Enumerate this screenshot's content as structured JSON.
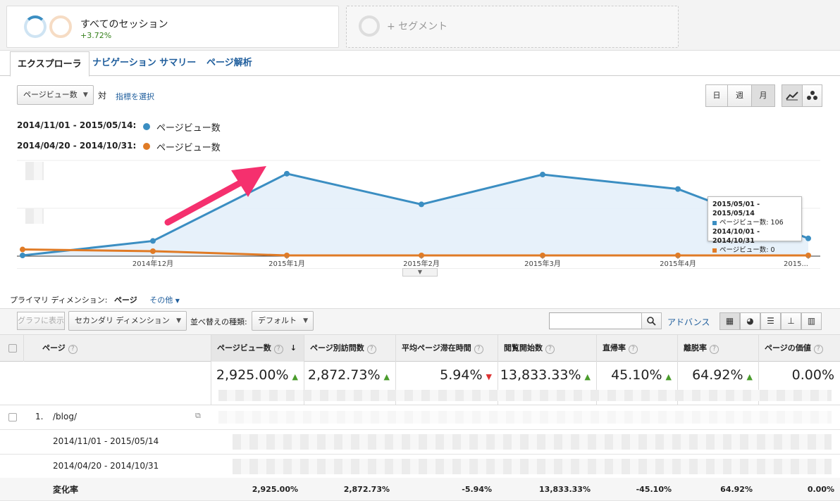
{
  "segments": {
    "active": {
      "title": "すべてのセッション",
      "change": "+3.72%"
    },
    "add_label": "+ セグメント"
  },
  "tabs": [
    {
      "label": "エクスプローラ",
      "active": true
    },
    {
      "label": "ナビゲーション サマリー",
      "active": false
    },
    {
      "label": "ページ解析",
      "active": false
    }
  ],
  "controls": {
    "metric_select": "ページビュー数",
    "vs_label": "対",
    "choose_metric": "指標を選択",
    "period_buttons": [
      "日",
      "週",
      "月"
    ],
    "active_period": "月"
  },
  "legend": [
    {
      "date": "2014/11/01 - 2015/05/14:",
      "label": "ページビュー数",
      "color": "#3b8ec2"
    },
    {
      "date": "2014/04/20 - 2014/10/31:",
      "label": "ページビュー数",
      "color": "#e07b26"
    }
  ],
  "chart_data": {
    "type": "line",
    "categories": [
      "",
      "2014年12月",
      "2015年1月",
      "2015年2月",
      "2015年3月",
      "2015年4月",
      "2015..."
    ],
    "series": [
      {
        "name": "2014/11/01 - 2015/05/14",
        "color": "#3b8ec2",
        "values": [
          0,
          0.17,
          0.96,
          0.6,
          0.95,
          0.78,
          0.2
        ]
      },
      {
        "name": "2014/04/20 - 2014/10/31",
        "color": "#e07b26",
        "values": [
          0.07,
          0.05,
          0,
          0,
          0,
          0,
          0
        ]
      }
    ]
  },
  "tooltip": {
    "range1": "2015/05/01 - 2015/05/14",
    "value1": "ページビュー数: 106",
    "range2": "2014/10/01 - 2014/10/31",
    "value2": "ページビュー数: 0"
  },
  "dimension": {
    "label": "プライマリ ディメンション:",
    "active": "ページ",
    "other": "その他"
  },
  "toolbar": {
    "plot_rows": "グラフに表示",
    "secondary_dimension": "セカンダリ ディメンション",
    "sort_label": "並べ替えの種類:",
    "sort_value": "デフォルト",
    "advanced": "アドバンス"
  },
  "table": {
    "columns": [
      "ページ",
      "ページビュー数",
      "ページ別訪問数",
      "平均ページ滞在時間",
      "閲覧開始数",
      "直帰率",
      "離脱率",
      "ページの価値"
    ],
    "summary": [
      {
        "value": "2,925.00%",
        "dir": "up"
      },
      {
        "value": "2,872.73%",
        "dir": "up"
      },
      {
        "value": "5.94%",
        "dir": "down"
      },
      {
        "value": "13,833.33%",
        "dir": "up"
      },
      {
        "value": "45.10%",
        "dir": "up"
      },
      {
        "value": "64.92%",
        "dir": "up"
      },
      {
        "value": "0.00%",
        "dir": ""
      }
    ],
    "row1": {
      "index": "1.",
      "page": "/blog/"
    },
    "range1": "2014/11/01 - 2015/05/14",
    "range2": "2014/04/20 - 2014/10/31",
    "change_label": "変化率",
    "change_values": [
      "2,925.00%",
      "2,872.73%",
      "-5.94%",
      "13,833.33%",
      "-45.10%",
      "64.92%",
      "0.00%"
    ]
  }
}
